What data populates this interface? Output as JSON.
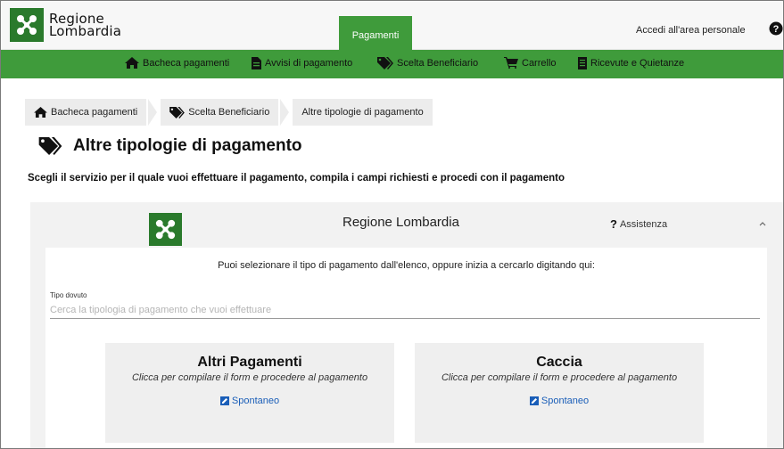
{
  "header": {
    "logo_line1": "Regione",
    "logo_line2": "Lombardia",
    "active_tab": "Pagamenti",
    "login_link": "Accedi all'area personale"
  },
  "nav": {
    "items": [
      {
        "label": "Bacheca pagamenti",
        "icon": "home-icon"
      },
      {
        "label": "Avvisi di pagamento",
        "icon": "document-icon"
      },
      {
        "label": "Scelta Beneficiario",
        "icon": "tags-icon"
      },
      {
        "label": "Carrello",
        "icon": "cart-icon"
      },
      {
        "label": "Ricevute e Quietanze",
        "icon": "receipt-icon"
      }
    ]
  },
  "breadcrumb": {
    "items": [
      "Bacheca pagamenti",
      "Scelta Beneficiario",
      "Altre tipologie di pagamento"
    ]
  },
  "page": {
    "title": "Altre tipologie di pagamento",
    "subtitle": "Scegli il servizio per il quale vuoi effettuare il pagamento, compila i campi richiesti e procedi con il pagamento"
  },
  "panel": {
    "title": "Regione Lombardia",
    "assist_label": "Assistenza",
    "hint": "Puoi selezionare il tipo di pagamento dall'elenco, oppure inizia a cercarlo digitando qui:",
    "field_label": "Tipo dovuto",
    "field_placeholder": "Cerca la tipologia di pagamento che vuoi effettuare",
    "cards": [
      {
        "title": "Altri Pagamenti",
        "desc": "Clicca per compilare il form e procedere al pagamento",
        "link": "Spontaneo"
      },
      {
        "title": "Caccia",
        "desc": "Clicca per compilare il form e procedere al pagamento",
        "link": "Spontaneo"
      }
    ]
  },
  "colors": {
    "brand_green": "#3f9b3b",
    "logo_green": "#2a7a2c",
    "link_blue": "#1a5eb8"
  }
}
